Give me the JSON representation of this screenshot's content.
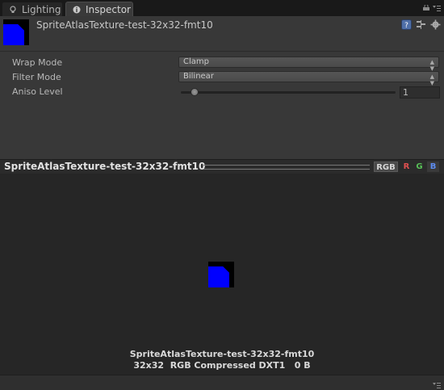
{
  "tabs": [
    {
      "label": "Lighting",
      "icon": "lighting-icon",
      "active": false
    },
    {
      "label": "Inspector",
      "icon": "info-icon",
      "active": true
    }
  ],
  "header": {
    "title": "SpriteAtlasTexture-test-32x32-fmt10",
    "icons": [
      "help-icon",
      "preset-icon",
      "gear-icon"
    ]
  },
  "properties": {
    "wrap_mode": {
      "label": "Wrap Mode",
      "value": "Clamp"
    },
    "filter_mode": {
      "label": "Filter Mode",
      "value": "Bilinear"
    },
    "aniso_level": {
      "label": "Aniso Level",
      "value": "1",
      "slider_fraction": 0.05
    }
  },
  "preview": {
    "title": "SpriteAtlasTexture-test-32x32-fmt10",
    "channels": [
      "RGB",
      "R",
      "G",
      "B"
    ],
    "name": "SpriteAtlasTexture-test-32x32-fmt10",
    "info": "32x32  RGB Compressed DXT1   0 B"
  },
  "colors": {
    "texture_fill": "#0000ff",
    "texture_bg": "#000000",
    "channel_r": "#e05050",
    "channel_g": "#58c058",
    "channel_b": "#5d8cf0"
  }
}
